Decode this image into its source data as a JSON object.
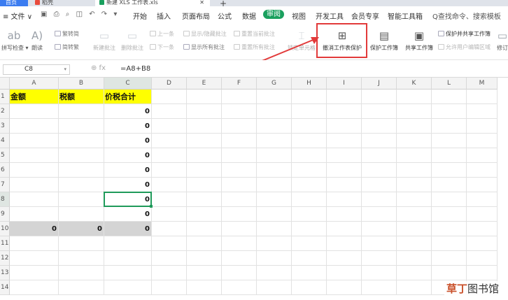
{
  "tabs": {
    "home": "首页",
    "doc": "稻壳",
    "file": "新建 XLS 工作表.xls",
    "close": "✕",
    "add": "+"
  },
  "menu": {
    "file": "≡ 文件 ∨",
    "items": [
      "开始",
      "插入",
      "页面布局",
      "公式",
      "数据",
      "审阅",
      "视图",
      "开发工具",
      "会员专享",
      "智能工具箱"
    ],
    "active_index": 5,
    "search": "Q查找命令、搜索模板"
  },
  "ribbon": {
    "spell": "拼写检查 ▾",
    "read": "朗读",
    "trad": "繁转简",
    "simp": "简转繁",
    "new_comment": "新建批注",
    "delete_comment": "删除批注",
    "prev": "上一条",
    "next": "下一条",
    "show_hide": "显示/隐藏批注",
    "show_all": "显示所有批注",
    "reset_current": "重置当前批注",
    "reset_all": "重置所有批注",
    "lock_cell": "锁定单元格",
    "unprotect_sheet": "撤消工作表保护",
    "protect_workbook": "保护工作簿",
    "share_workbook": "共享工作簿",
    "protect_share": "保护并共享工作簿",
    "allow_edit": "允许用户编辑区域",
    "revise": "修订"
  },
  "formula_bar": {
    "cell_ref": "C8",
    "fx": "⊕  fx",
    "formula": "=A8+B8"
  },
  "grid": {
    "columns": [
      "A",
      "B",
      "C",
      "D",
      "E",
      "F",
      "G",
      "H",
      "I",
      "J",
      "K",
      "L",
      "M"
    ],
    "rows": [
      "1",
      "2",
      "3",
      "4",
      "5",
      "6",
      "7",
      "8",
      "9",
      "10",
      "11",
      "12",
      "13",
      "14"
    ],
    "headers": [
      "金额",
      "税额",
      "价税合计"
    ],
    "c_values": [
      "0",
      "0",
      "0",
      "0",
      "0",
      "0",
      "0",
      "0"
    ],
    "total_row": [
      "0",
      "0",
      "0"
    ],
    "selected_cell": "C8"
  },
  "watermark": {
    "brand": "草丁",
    "rest": "图书馆"
  },
  "colors": {
    "accent": "#1aa05e",
    "highlight": "#e23a3a",
    "header_fill": "#ffff00",
    "total_fill": "#d4d4d4"
  }
}
